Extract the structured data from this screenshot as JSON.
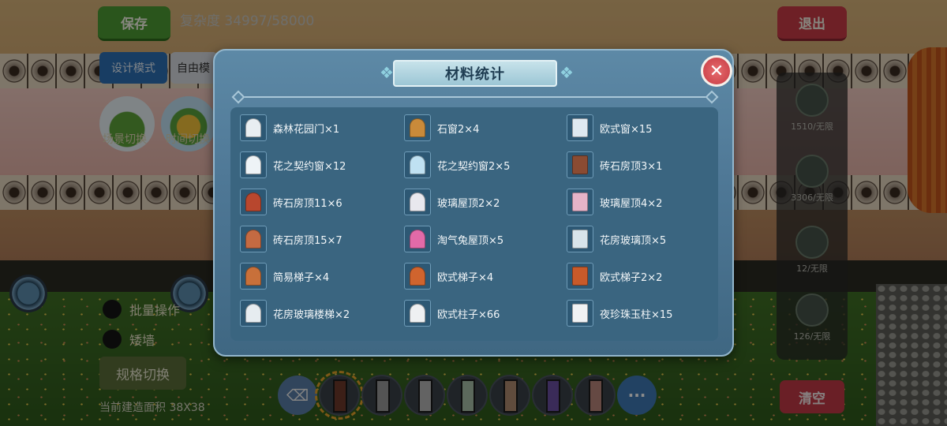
{
  "top_bar": {
    "save_label": "保存",
    "complexity_text": "复杂度 34997/58000",
    "exit_label": "退出"
  },
  "mode_bar": {
    "design_mode_label": "设计模式",
    "free_label": "自由模"
  },
  "scene_tools": {
    "tool_1_label": "场景切换",
    "tool_2_label": "时间切换"
  },
  "options": {
    "batch_label": "批量操作",
    "dwarf_label": "矮墙"
  },
  "spec_switch_label": "规格切换",
  "area_text": "当前建造面积 38X38",
  "right_panel": {
    "counts": [
      "1510/无限",
      "3306/无限",
      "12/无限",
      "126/无限"
    ],
    "clear_label": "清空"
  },
  "modal": {
    "title": "材料统计",
    "close_icon": "close-icon",
    "items": [
      {
        "label": "森林花园门×1",
        "icon": "arch-gate-icon",
        "color": "#e8eef2"
      },
      {
        "label": "石窗2×4",
        "icon": "stone-window-icon",
        "color": "#c98a3a"
      },
      {
        "label": "欧式窗×15",
        "icon": "euro-window-icon",
        "color": "#dfe9f1"
      },
      {
        "label": "花之契约窗×12",
        "icon": "lattice-window-icon",
        "color": "#eef3f6"
      },
      {
        "label": "花之契约窗2×5",
        "icon": "curtain-window-icon",
        "color": "#bfe1f2"
      },
      {
        "label": "砖石房顶3×1",
        "icon": "brick-roof-icon",
        "color": "#8a4b32"
      },
      {
        "label": "砖石房顶11×6",
        "icon": "cone-roof-icon",
        "color": "#b8472e"
      },
      {
        "label": "玻璃屋顶2×2",
        "icon": "glass-pyramid-icon",
        "color": "#e8e8ee"
      },
      {
        "label": "玻璃屋顶4×2",
        "icon": "glass-pyramid-pink-icon",
        "color": "#e5b3c8"
      },
      {
        "label": "砖石房顶15×7",
        "icon": "brick-roof-flat-icon",
        "color": "#c46a42"
      },
      {
        "label": "淘气兔屋顶×5",
        "icon": "bunny-roof-icon",
        "color": "#e26aa8"
      },
      {
        "label": "花房玻璃顶×5",
        "icon": "greenhouse-roof-icon",
        "color": "#d8e4ea"
      },
      {
        "label": "简易梯子×4",
        "icon": "ladder-icon",
        "color": "#c8703a"
      },
      {
        "label": "欧式梯子×4",
        "icon": "spiral-stair-icon",
        "color": "#d0642e"
      },
      {
        "label": "欧式梯子2×2",
        "icon": "straight-stair-icon",
        "color": "#c85a2a"
      },
      {
        "label": "花房玻璃楼梯×2",
        "icon": "glass-stair-icon",
        "color": "#e6ecf0"
      },
      {
        "label": "欧式柱子×66",
        "icon": "column-icon",
        "color": "#eef0f2"
      },
      {
        "label": "夜珍珠玉柱×15",
        "icon": "lamp-pillar-icon",
        "color": "#f0f2f4"
      }
    ]
  }
}
